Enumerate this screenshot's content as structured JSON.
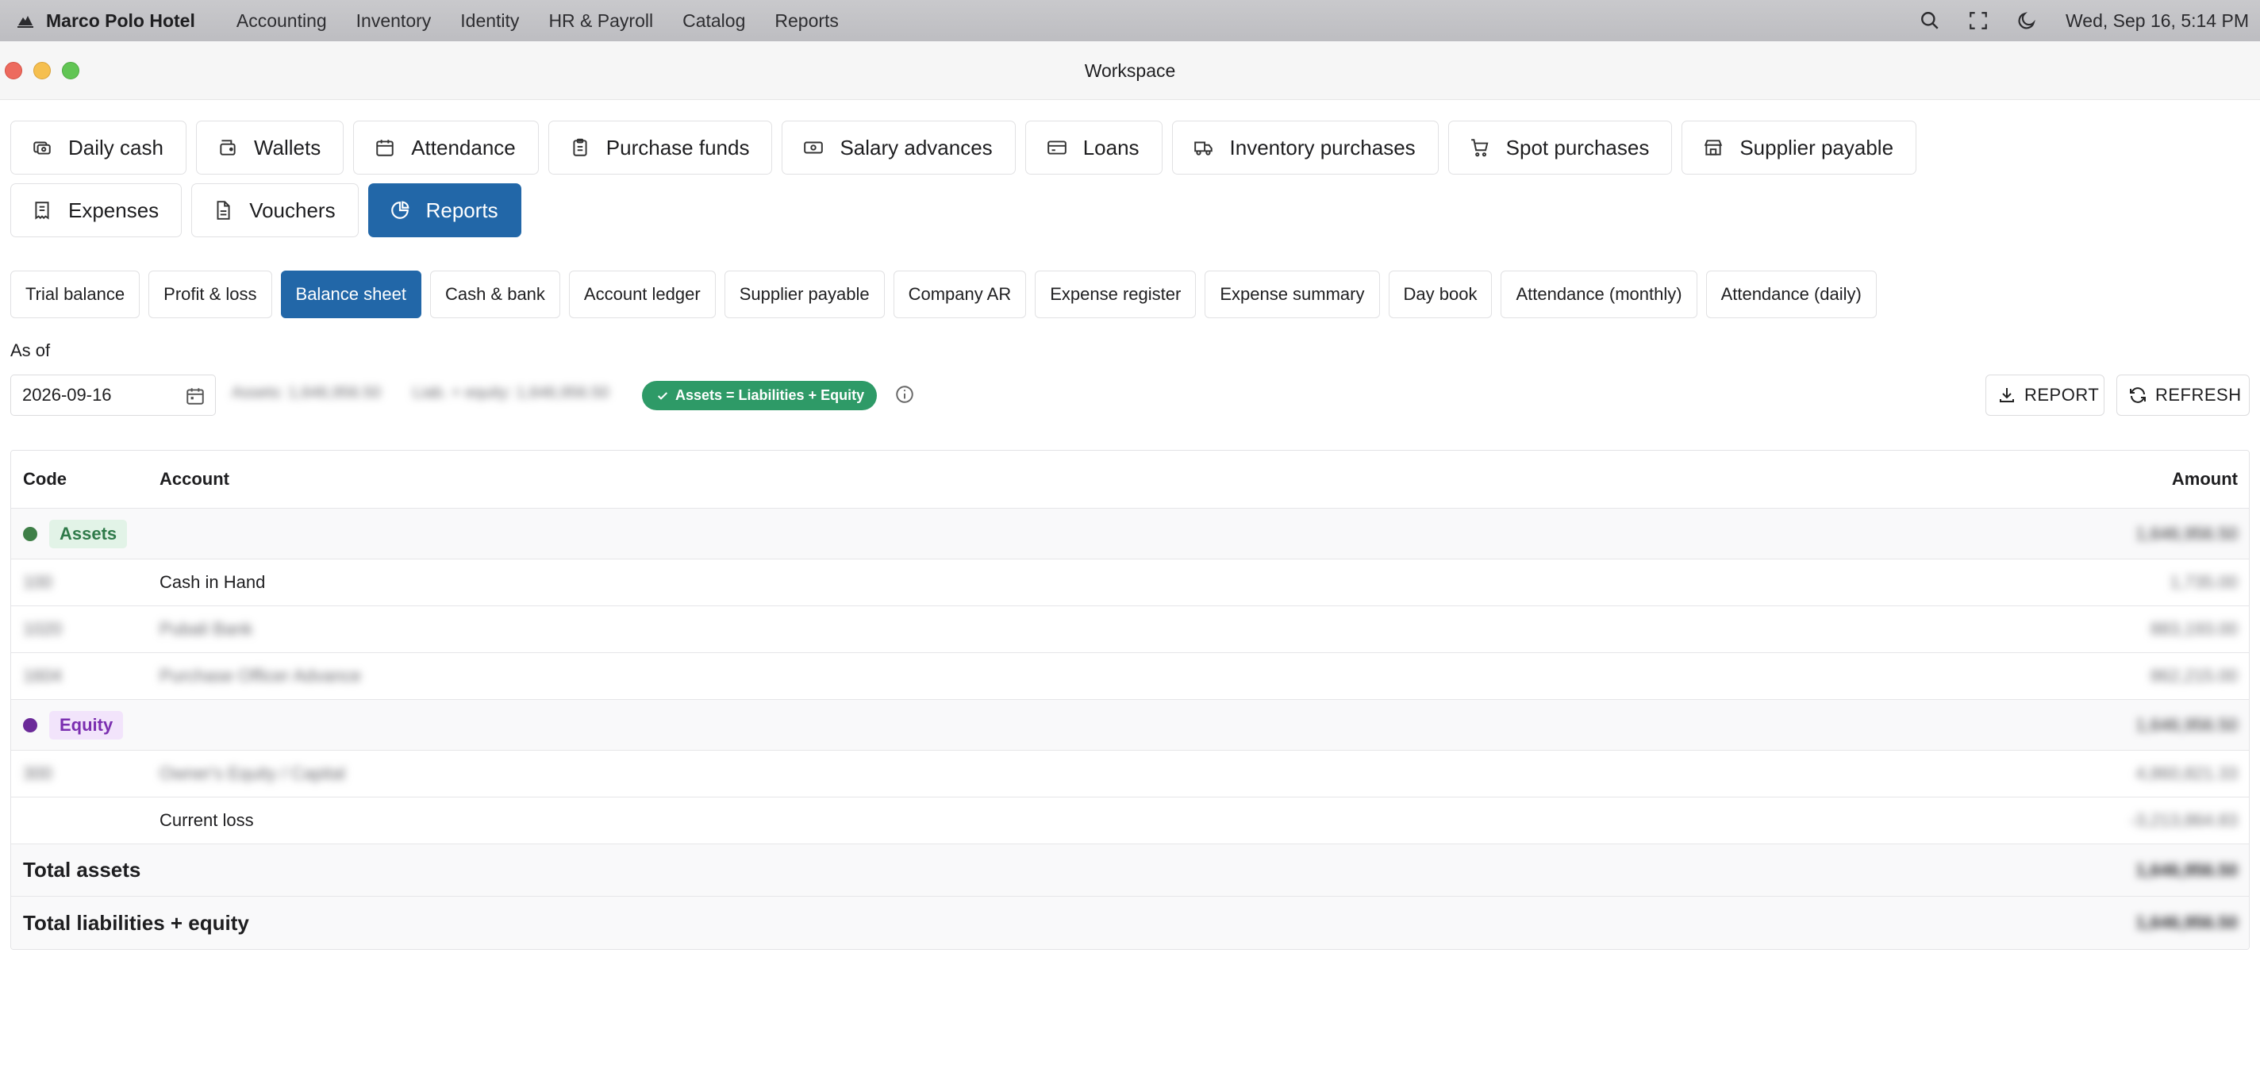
{
  "menubar": {
    "app_name": "Marco Polo Hotel",
    "menus": [
      "Accounting",
      "Inventory",
      "Identity",
      "HR & Payroll",
      "Catalog",
      "Reports"
    ],
    "clock": "Wed, Sep 16, 5:14 PM",
    "icons": [
      "search-icon",
      "fullscreen-icon",
      "dark-mode-icon"
    ]
  },
  "window": {
    "title": "Workspace"
  },
  "primary_tabs": [
    {
      "label": "Daily cash",
      "icon": "cash-register-icon"
    },
    {
      "label": "Wallets",
      "icon": "wallet-icon"
    },
    {
      "label": "Attendance",
      "icon": "calendar-icon"
    },
    {
      "label": "Purchase funds",
      "icon": "clipboard-icon"
    },
    {
      "label": "Salary advances",
      "icon": "banknote-icon"
    },
    {
      "label": "Loans",
      "icon": "credit-card-icon"
    },
    {
      "label": "Inventory purchases",
      "icon": "truck-icon"
    },
    {
      "label": "Spot purchases",
      "icon": "cart-icon"
    },
    {
      "label": "Supplier payable",
      "icon": "store-icon"
    },
    {
      "label": "Expenses",
      "icon": "receipt-icon"
    },
    {
      "label": "Vouchers",
      "icon": "document-icon"
    },
    {
      "label": "Reports",
      "icon": "pie-chart-icon",
      "active": true
    }
  ],
  "sub_tabs": [
    {
      "label": "Trial balance"
    },
    {
      "label": "Profit & loss"
    },
    {
      "label": "Balance sheet",
      "active": true
    },
    {
      "label": "Cash & bank"
    },
    {
      "label": "Account ledger"
    },
    {
      "label": "Supplier payable"
    },
    {
      "label": "Company AR"
    },
    {
      "label": "Expense register"
    },
    {
      "label": "Expense summary"
    },
    {
      "label": "Day book"
    },
    {
      "label": "Attendance (monthly)"
    },
    {
      "label": "Attendance (daily)"
    }
  ],
  "filters": {
    "as_of_label": "As of",
    "date_value": "2026-09-16",
    "assets_summary": "Assets: 1,646,956.50",
    "liab_equity_summary": "Liab. + equity: 1,646,956.50",
    "balance_badge": "Assets = Liabilities + Equity",
    "report_button": "REPORT",
    "refresh_button": "REFRESH"
  },
  "table": {
    "headers": {
      "code": "Code",
      "account": "Account",
      "amount": "Amount"
    },
    "groups": [
      {
        "name": "Assets",
        "color": "#3f7f48",
        "total": "1,646,956.50",
        "rows": [
          {
            "code": "100",
            "account": "Cash in Hand",
            "amount": "1,735.00",
            "account_hidden": false
          },
          {
            "code": "1020",
            "account": "Pubali Bank",
            "amount": "883,193.00",
            "account_hidden": true
          },
          {
            "code": "1604",
            "account": "Purchase Officer Advance",
            "amount": "862,215.00",
            "account_hidden": true
          }
        ]
      },
      {
        "name": "Equity",
        "color": "#6b2a99",
        "total": "1,646,956.50",
        "rows": [
          {
            "code": "300",
            "account": "Owner's Equity / Capital",
            "amount": "4,860,821.33",
            "account_hidden": true
          },
          {
            "code": "",
            "account": "Current loss",
            "amount": "-3,213,864.83",
            "account_hidden": false
          }
        ]
      }
    ],
    "totals": [
      {
        "label": "Total assets",
        "amount": "1,646,956.50"
      },
      {
        "label": "Total liabilities + equity",
        "amount": "1,646,956.50"
      }
    ]
  },
  "colors": {
    "accent": "#2267a8",
    "success": "#2e9a67"
  }
}
